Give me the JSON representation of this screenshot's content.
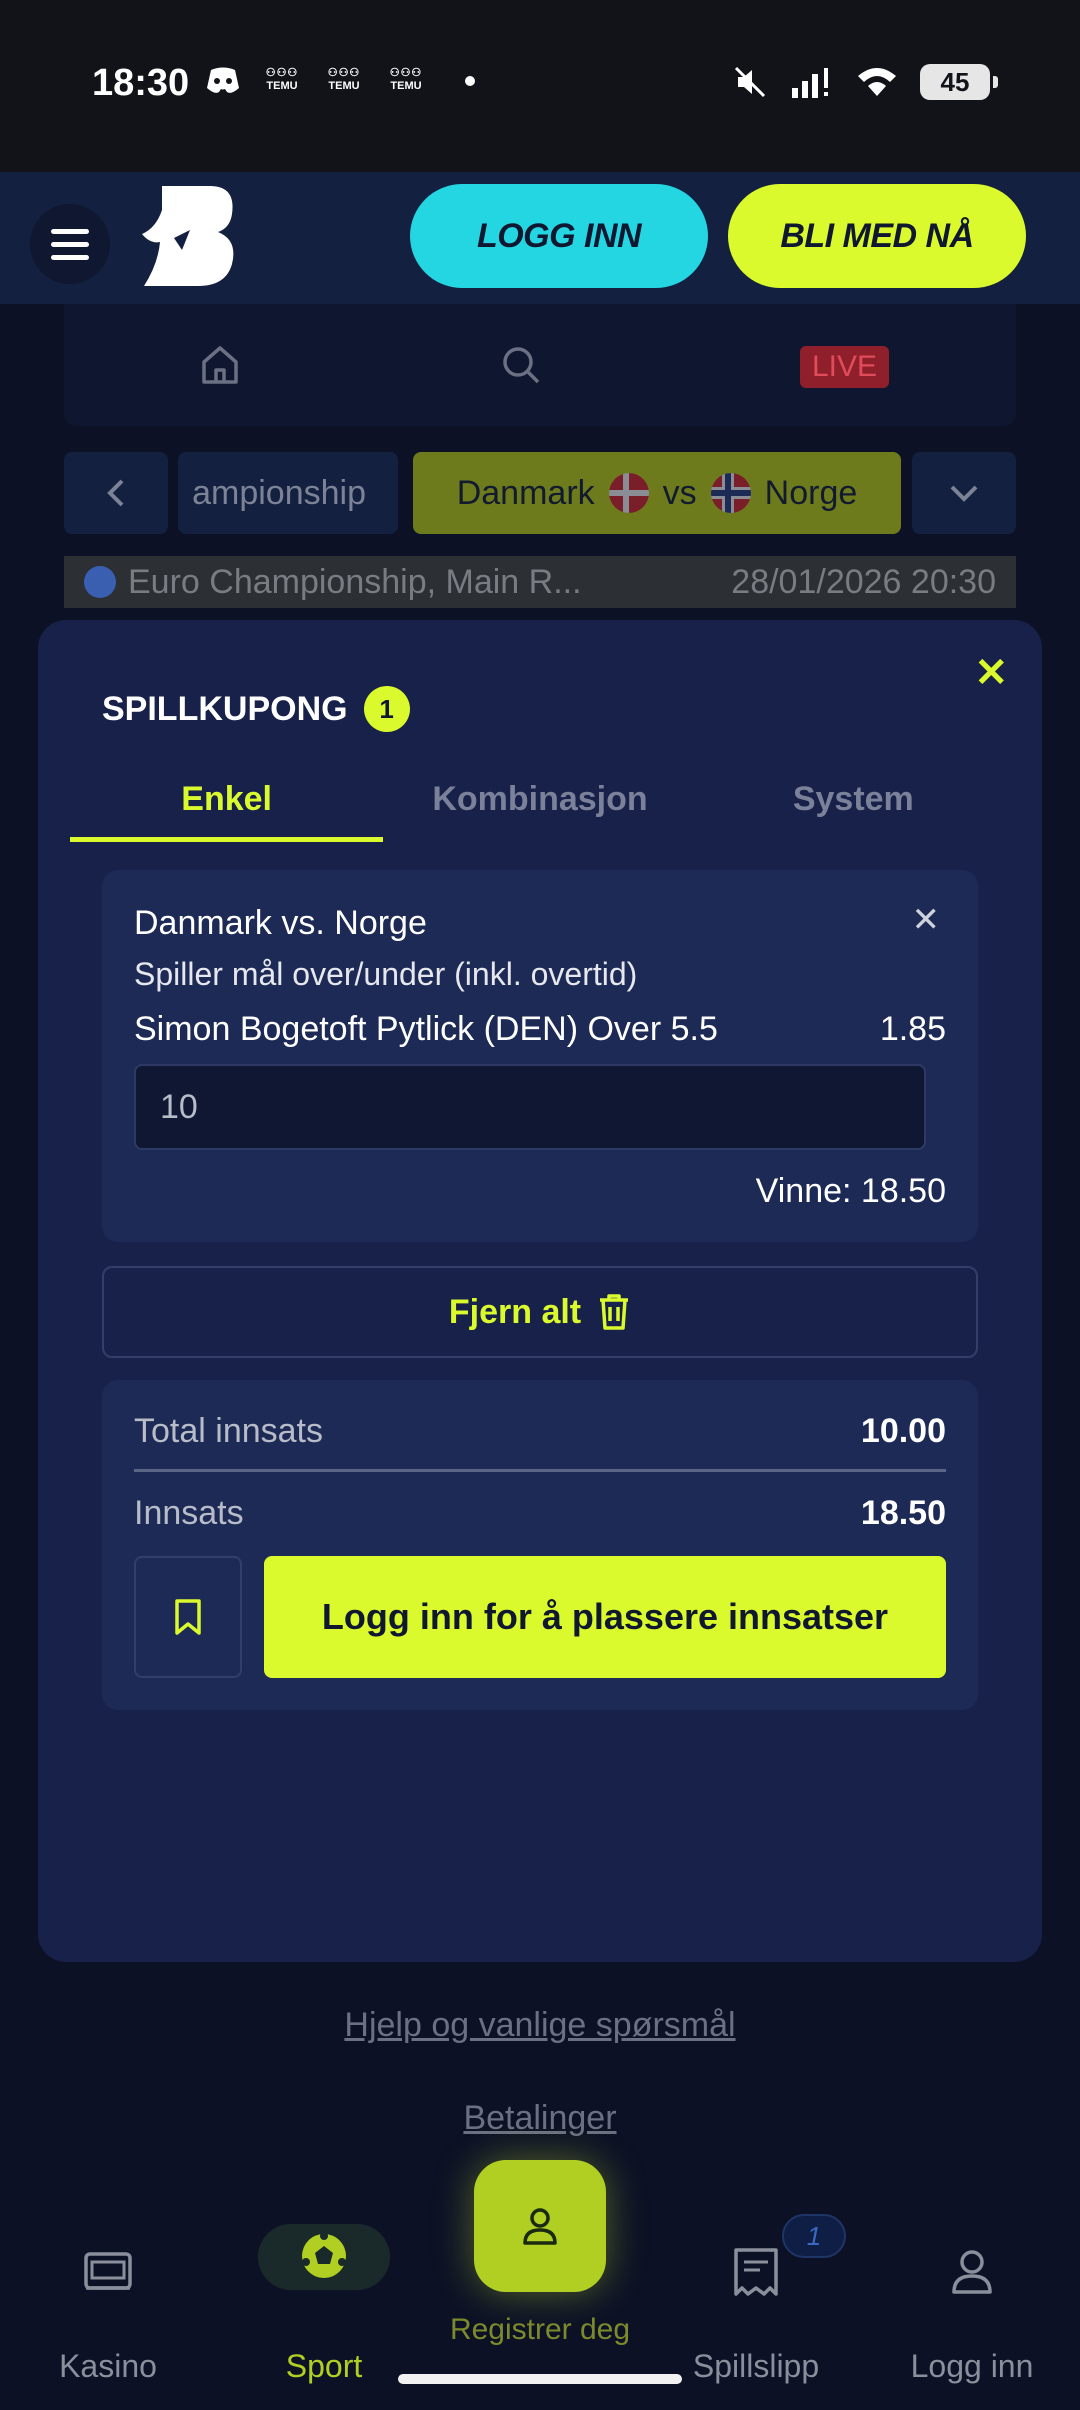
{
  "status": {
    "time": "18:30",
    "notifications": [
      "TEMU",
      "TEMU",
      "TEMU"
    ],
    "battery": "45"
  },
  "header": {
    "login_label": "LOGG INN",
    "join_label": "BLI MED NÅ"
  },
  "nav": {
    "live_label": "LIVE"
  },
  "matchbar": {
    "prev_tab": "ampionship",
    "home_team": "Danmark",
    "vs": "vs",
    "away_team": "Norge"
  },
  "event": {
    "competition": "Euro Championship, Main R...",
    "datetime": "28/01/2026 20:30"
  },
  "betslip": {
    "title": "SPILLKUPONG",
    "count": "1",
    "tabs": [
      "Enkel",
      "Kombinasjon",
      "System"
    ],
    "active_tab": "Enkel",
    "bet": {
      "match": "Danmark vs. Norge",
      "market": "Spiller mål over/under (inkl. overtid)",
      "selection": "Simon Bogetoft Pytlick (DEN) Over 5.5",
      "odds": "1.85",
      "stake": "10",
      "win_text": "Vinne: 18.50"
    },
    "remove_all_label": "Fjern alt",
    "total_stake_label": "Total innsats",
    "total_stake_value": "10.00",
    "stake_label": "Innsats",
    "stake_value": "18.50",
    "place_label": "Logg inn for å plassere innsatser"
  },
  "footer": {
    "help_link": "Hjelp og vanlige spørsmål",
    "payments_link": "Betalinger"
  },
  "bottom_nav": {
    "items": [
      "Kasino",
      "Sport",
      "Registrer deg",
      "Spillslipp",
      "Logg inn"
    ],
    "slip_badge": "1"
  },
  "colors": {
    "accent": "#dafa2d",
    "cyan": "#23d6e2",
    "panel": "#172149",
    "background": "#0c1125"
  }
}
